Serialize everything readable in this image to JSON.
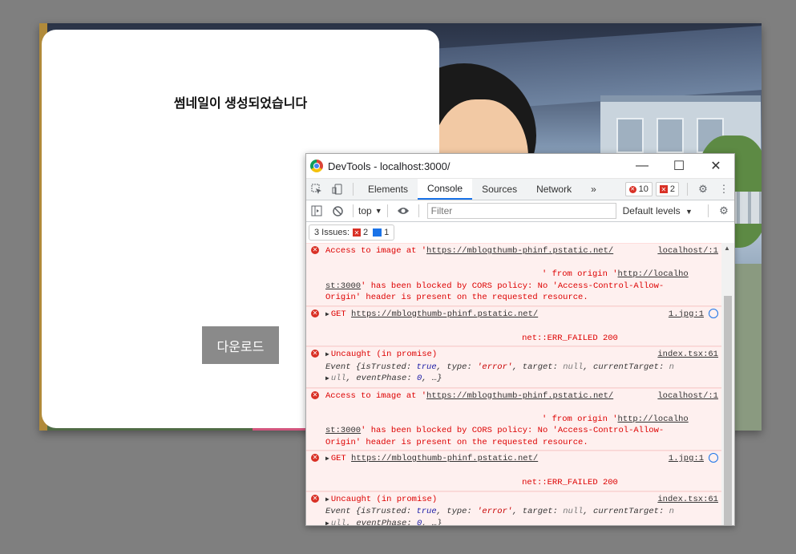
{
  "modal": {
    "title": "썸네일이 생성되었습니다",
    "download_label": "다운로드"
  },
  "devtools": {
    "window_title": "DevTools - localhost:3000/",
    "window_controls": {
      "minimize": "—",
      "maximize": "☐",
      "close": "✕"
    },
    "tabs": [
      "Elements",
      "Console",
      "Sources",
      "Network"
    ],
    "active_tab": "Console",
    "more_tabs": "»",
    "error_count": "10",
    "warning_count": "2",
    "toolbar": {
      "context": "top",
      "filter_placeholder": "Filter",
      "levels": "Default levels"
    },
    "issues": {
      "label": "3 Issues:",
      "errors": "2",
      "info": "1"
    },
    "messages": [
      {
        "type": "cors",
        "prefix": "Access to image at '",
        "url": "https://mblogthumb-phinf.pstatic.net/",
        "source": "localhost/:1",
        "line2_pre": "' from origin '",
        "origin1": "http://localho",
        "origin2": "st:3000",
        "line3_post": "' has been blocked by CORS policy: No 'Access-Control-Allow-",
        "line4": "Origin' header is present on the requested resource."
      },
      {
        "type": "get",
        "method": "GET",
        "url": "https://mblogthumb-phinf.pstatic.net/",
        "source": "1.jpg:1",
        "status": "net::ERR_FAILED 200"
      },
      {
        "type": "uncaught",
        "text": "Uncaught (in promise)",
        "source": "index.tsx:61",
        "event_label": "Event",
        "event_body1_a": "{isTrusted: ",
        "event_body1_b": "true",
        "event_body1_c": ", type: ",
        "event_body1_d": "'error'",
        "event_body1_e": ", target: ",
        "event_body1_f": "null",
        "event_body1_g": ", currentTarget: ",
        "event_body1_h": "n",
        "event_body2_a": "ull",
        "event_body2_b": ", eventPhase: ",
        "event_body2_c": "0",
        "event_body2_d": ", …}"
      }
    ]
  }
}
